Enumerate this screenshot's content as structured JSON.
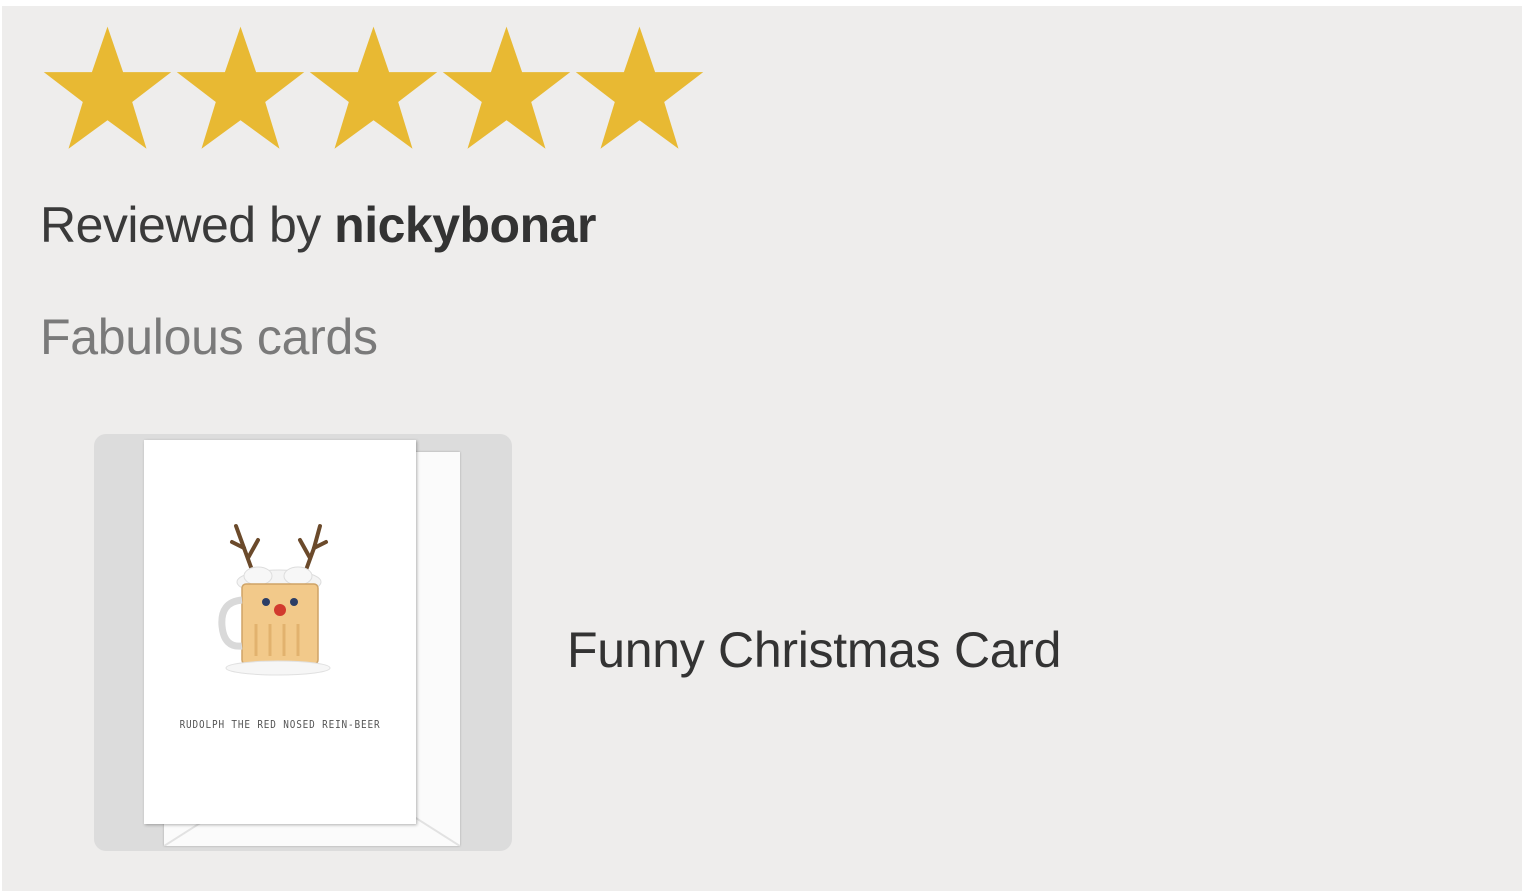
{
  "review": {
    "rating": 5,
    "max_rating": 5,
    "star_color": "#e8b933",
    "reviewed_by_prefix": "Reviewed by ",
    "reviewer_name": "nickybonar",
    "text": "Fabulous cards"
  },
  "product": {
    "title": "Funny Christmas Card",
    "image_icon": "christmas-card-reindeer-beer-image",
    "card_caption": "RUDOLPH THE RED NOSED REIN-BEER"
  },
  "colors": {
    "card_background": "#eeedec",
    "thumb_background": "#dcdcdc"
  }
}
